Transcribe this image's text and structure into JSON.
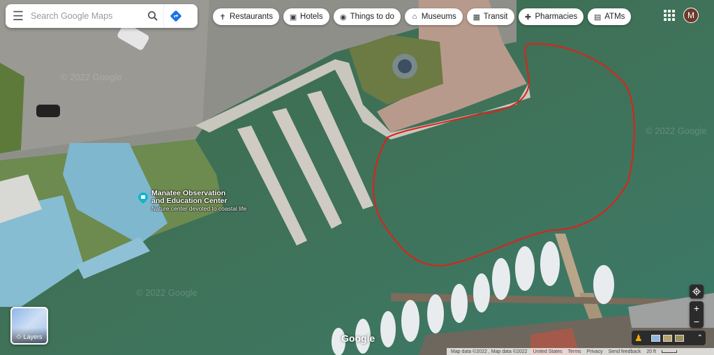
{
  "search": {
    "placeholder": "Search Google Maps"
  },
  "chips": [
    {
      "icon": "restaurant-icon",
      "label": "Restaurants"
    },
    {
      "icon": "hotel-icon",
      "label": "Hotels"
    },
    {
      "icon": "camera-icon",
      "label": "Things to do"
    },
    {
      "icon": "museum-icon",
      "label": "Museums"
    },
    {
      "icon": "transit-icon",
      "label": "Transit"
    },
    {
      "icon": "pharmacy-icon",
      "label": "Pharmacies"
    },
    {
      "icon": "atm-icon",
      "label": "ATMs"
    }
  ],
  "account": {
    "initial": "M"
  },
  "poi": {
    "name": "Manatee Observation and Education Center",
    "subtitle": "Nature center devoted to coastal life"
  },
  "layers": {
    "label": "Layers"
  },
  "logo": "Google",
  "watermark": "© 2022 Google",
  "attribution": {
    "map_data": "Map data ©2022 , Map data ©2022",
    "country": "United States",
    "terms": "Terms",
    "privacy": "Privacy",
    "feedback": "Send feedback",
    "scale": "20 ft"
  },
  "colors": {
    "water": "#3f6d55",
    "annotation": "#e0201a",
    "chip_bg": "#ffffff",
    "controls_bg": "#2b2b2b"
  }
}
